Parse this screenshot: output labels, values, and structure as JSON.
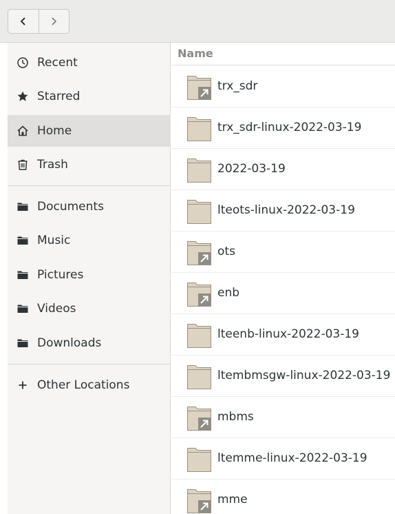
{
  "nav": {
    "back_icon": "chevron-left-icon",
    "forward_icon": "chevron-right-icon"
  },
  "sidebar": {
    "items": [
      {
        "label": "Recent",
        "icon": "clock-icon"
      },
      {
        "label": "Starred",
        "icon": "star-icon"
      },
      {
        "label": "Home",
        "icon": "home-icon",
        "active": true
      },
      {
        "label": "Trash",
        "icon": "trash-icon"
      },
      {
        "label": "Documents",
        "icon": "folder-icon"
      },
      {
        "label": "Music",
        "icon": "folder-icon"
      },
      {
        "label": "Pictures",
        "icon": "folder-icon"
      },
      {
        "label": "Videos",
        "icon": "folder-icon"
      },
      {
        "label": "Downloads",
        "icon": "folder-icon"
      },
      {
        "label": "Other Locations",
        "icon": "plus-icon"
      }
    ]
  },
  "files": {
    "column_header": "Name",
    "rows": [
      {
        "name": "trx_sdr",
        "link": true
      },
      {
        "name": "trx_sdr-linux-2022-03-19",
        "link": false
      },
      {
        "name": "2022-03-19",
        "link": false
      },
      {
        "name": "lteots-linux-2022-03-19",
        "link": false
      },
      {
        "name": "ots",
        "link": true
      },
      {
        "name": "enb",
        "link": true
      },
      {
        "name": "lteenb-linux-2022-03-19",
        "link": false
      },
      {
        "name": "ltembmsgw-linux-2022-03-19",
        "link": false
      },
      {
        "name": "mbms",
        "link": true
      },
      {
        "name": "ltemme-linux-2022-03-19",
        "link": false
      },
      {
        "name": "mme",
        "link": true
      }
    ]
  },
  "colors": {
    "folder_fill": "#ddd3c3",
    "folder_stroke": "#9a9184",
    "link_badge": "#8f8c86",
    "sidebar_active": "#e0dfdd"
  }
}
